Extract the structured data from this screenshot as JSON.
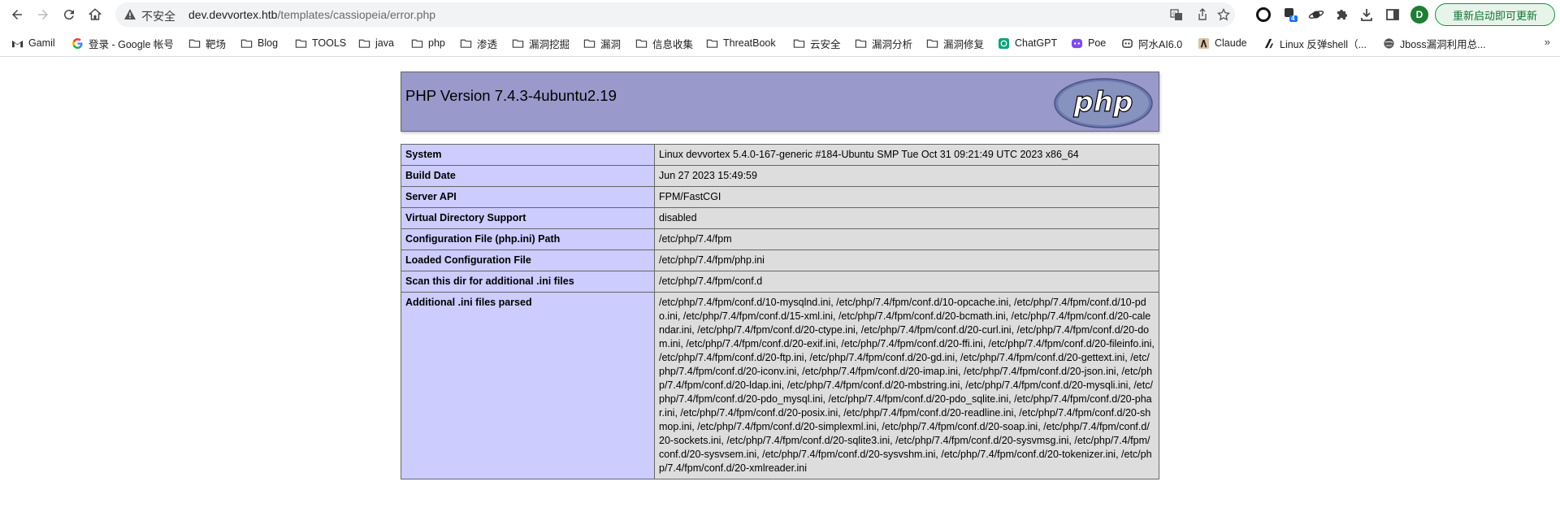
{
  "browser": {
    "security_label": "不安全",
    "url_host": "dev.devvortex.htb",
    "url_path": "/templates/cassiopeia/error.php",
    "profile_initial": "D",
    "extension_badge": "4",
    "update_button": "重新启动即可更新"
  },
  "bookmarks": [
    {
      "label": "Gamil",
      "icon": "gmail-icon"
    },
    {
      "label": "登录 - Google 帐号",
      "icon": "google-icon"
    },
    {
      "label": "靶场",
      "icon": "folder-icon"
    },
    {
      "label": "Blog",
      "icon": "folder-icon"
    },
    {
      "label": "TOOLS",
      "icon": "folder-icon"
    },
    {
      "label": "java",
      "icon": "folder-icon"
    },
    {
      "label": "php",
      "icon": "folder-icon"
    },
    {
      "label": "渗透",
      "icon": "folder-icon"
    },
    {
      "label": "漏洞挖掘",
      "icon": "folder-icon"
    },
    {
      "label": "漏洞",
      "icon": "folder-icon"
    },
    {
      "label": "信息收集",
      "icon": "folder-icon"
    },
    {
      "label": "ThreatBook",
      "icon": "folder-icon"
    },
    {
      "label": "云安全",
      "icon": "folder-icon"
    },
    {
      "label": "漏洞分析",
      "icon": "folder-icon"
    },
    {
      "label": "漏洞修复",
      "icon": "folder-icon"
    },
    {
      "label": "ChatGPT",
      "icon": "chatgpt-icon"
    },
    {
      "label": "Poe",
      "icon": "poe-icon"
    },
    {
      "label": "阿水AI6.0",
      "icon": "robot-icon"
    },
    {
      "label": "Claude",
      "icon": "claude-icon"
    },
    {
      "label": "Linux 反弹shell（...",
      "icon": "link-icon"
    },
    {
      "label": "Jboss漏洞利用总...",
      "icon": "globe-icon"
    }
  ],
  "bookmarks_more": "»",
  "php": {
    "title": "PHP Version 7.4.3-4ubuntu2.19",
    "logo_text": "php",
    "rows": [
      {
        "key": "System",
        "value": "Linux devvortex 5.4.0-167-generic #184-Ubuntu SMP Tue Oct 31 09:21:49 UTC 2023 x86_64"
      },
      {
        "key": "Build Date",
        "value": "Jun 27 2023 15:49:59"
      },
      {
        "key": "Server API",
        "value": "FPM/FastCGI"
      },
      {
        "key": "Virtual Directory Support",
        "value": "disabled"
      },
      {
        "key": "Configuration File (php.ini) Path",
        "value": "/etc/php/7.4/fpm"
      },
      {
        "key": "Loaded Configuration File",
        "value": "/etc/php/7.4/fpm/php.ini"
      },
      {
        "key": "Scan this dir for additional .ini files",
        "value": "/etc/php/7.4/fpm/conf.d"
      },
      {
        "key": "Additional .ini files parsed",
        "value": "/etc/php/7.4/fpm/conf.d/10-mysqlnd.ini, /etc/php/7.4/fpm/conf.d/10-opcache.ini, /etc/php/7.4/fpm/conf.d/10-pdo.ini, /etc/php/7.4/fpm/conf.d/15-xml.ini, /etc/php/7.4/fpm/conf.d/20-bcmath.ini, /etc/php/7.4/fpm/conf.d/20-calendar.ini, /etc/php/7.4/fpm/conf.d/20-ctype.ini, /etc/php/7.4/fpm/conf.d/20-curl.ini, /etc/php/7.4/fpm/conf.d/20-dom.ini, /etc/php/7.4/fpm/conf.d/20-exif.ini, /etc/php/7.4/fpm/conf.d/20-ffi.ini, /etc/php/7.4/fpm/conf.d/20-fileinfo.ini, /etc/php/7.4/fpm/conf.d/20-ftp.ini, /etc/php/7.4/fpm/conf.d/20-gd.ini, /etc/php/7.4/fpm/conf.d/20-gettext.ini, /etc/php/7.4/fpm/conf.d/20-iconv.ini, /etc/php/7.4/fpm/conf.d/20-imap.ini, /etc/php/7.4/fpm/conf.d/20-json.ini, /etc/php/7.4/fpm/conf.d/20-ldap.ini, /etc/php/7.4/fpm/conf.d/20-mbstring.ini, /etc/php/7.4/fpm/conf.d/20-mysqli.ini, /etc/php/7.4/fpm/conf.d/20-pdo_mysql.ini, /etc/php/7.4/fpm/conf.d/20-pdo_sqlite.ini, /etc/php/7.4/fpm/conf.d/20-phar.ini, /etc/php/7.4/fpm/conf.d/20-posix.ini, /etc/php/7.4/fpm/conf.d/20-readline.ini, /etc/php/7.4/fpm/conf.d/20-shmop.ini, /etc/php/7.4/fpm/conf.d/20-simplexml.ini, /etc/php/7.4/fpm/conf.d/20-soap.ini, /etc/php/7.4/fpm/conf.d/20-sockets.ini, /etc/php/7.4/fpm/conf.d/20-sqlite3.ini, /etc/php/7.4/fpm/conf.d/20-sysvmsg.ini, /etc/php/7.4/fpm/conf.d/20-sysvsem.ini, /etc/php/7.4/fpm/conf.d/20-sysvshm.ini, /etc/php/7.4/fpm/conf.d/20-tokenizer.ini, /etc/php/7.4/fpm/conf.d/20-xmlreader.ini"
      }
    ]
  },
  "colors": {
    "php_header_bg": "#9999cc",
    "key_cell_bg": "#ccccff",
    "value_cell_bg": "#dddddd",
    "update_accent": "#137333"
  }
}
